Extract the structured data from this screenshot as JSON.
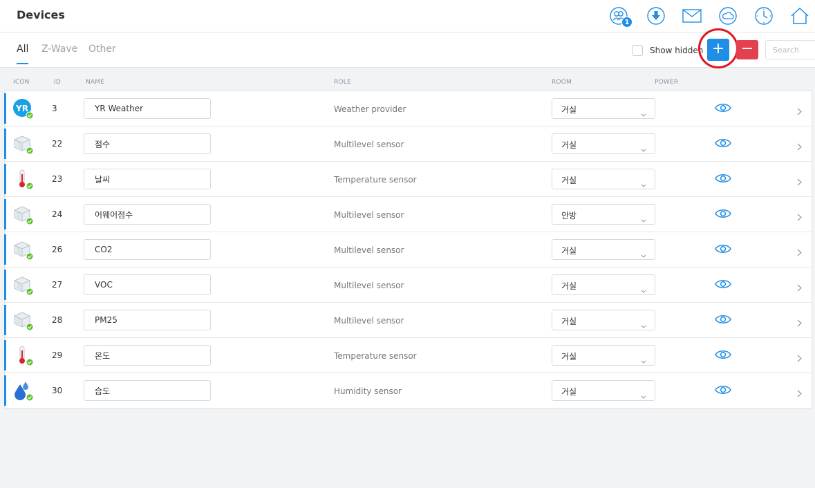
{
  "header": {
    "title": "Devices",
    "notification_count": "1"
  },
  "tabs": [
    {
      "label": "All",
      "active": true
    },
    {
      "label": "Z-Wave",
      "active": false
    },
    {
      "label": "Other",
      "active": false
    }
  ],
  "toolbar": {
    "show_hidden_label": "Show hidden",
    "add_label": "+",
    "remove_label": "−",
    "search_placeholder": "Search"
  },
  "columns": [
    "ICON",
    "ID",
    "NAME",
    "ROLE",
    "ROOM",
    "POWER"
  ],
  "rows": [
    {
      "icon": "yr-weather-icon",
      "id": "3",
      "name": "YR Weather",
      "role": "Weather provider",
      "room": "거실"
    },
    {
      "icon": "multilevel-sensor-icon",
      "id": "22",
      "name": "점수",
      "role": "Multilevel sensor",
      "room": "거실"
    },
    {
      "icon": "thermometer-icon",
      "id": "23",
      "name": "날씨",
      "role": "Temperature sensor",
      "room": "거실"
    },
    {
      "icon": "multilevel-sensor-icon",
      "id": "24",
      "name": "어웨어점수",
      "role": "Multilevel sensor",
      "room": "안방"
    },
    {
      "icon": "multilevel-sensor-icon",
      "id": "26",
      "name": "CO2",
      "role": "Multilevel sensor",
      "room": "거실"
    },
    {
      "icon": "multilevel-sensor-icon",
      "id": "27",
      "name": "VOC",
      "role": "Multilevel sensor",
      "room": "거실"
    },
    {
      "icon": "multilevel-sensor-icon",
      "id": "28",
      "name": "PM25",
      "role": "Multilevel sensor",
      "room": "거실"
    },
    {
      "icon": "thermometer-icon",
      "id": "29",
      "name": "온도",
      "role": "Temperature sensor",
      "room": "거실"
    },
    {
      "icon": "humidity-icon",
      "id": "30",
      "name": "습도",
      "role": "Humidity sensor",
      "room": "거실"
    }
  ],
  "colors": {
    "accent": "#1e8ee6",
    "danger": "#e34050",
    "status_ok": "#5cbf2a",
    "highlight_circle": "#e0141e"
  }
}
